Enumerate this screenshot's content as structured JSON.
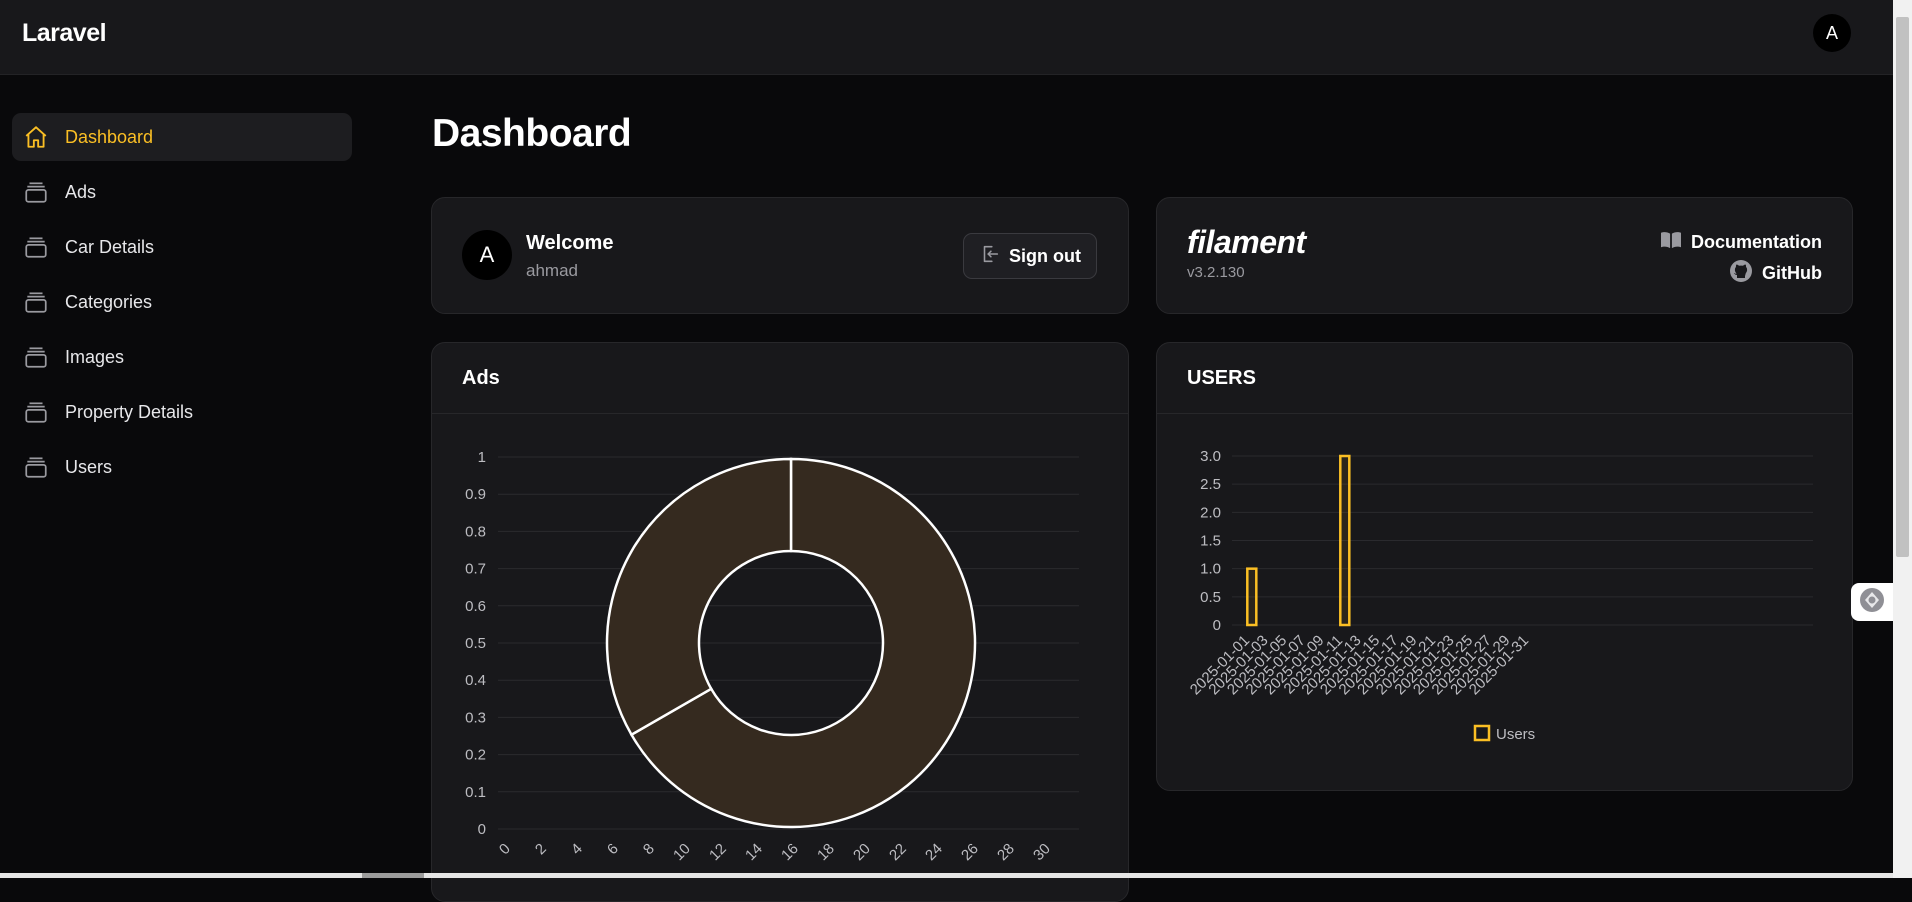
{
  "app": {
    "brand": "Laravel",
    "avatar_initial": "A"
  },
  "sidebar": {
    "items": [
      {
        "label": "Dashboard",
        "icon": "home-icon",
        "active": true
      },
      {
        "label": "Ads",
        "icon": "stack-icon"
      },
      {
        "label": "Car Details",
        "icon": "stack-icon"
      },
      {
        "label": "Categories",
        "icon": "stack-icon"
      },
      {
        "label": "Images",
        "icon": "stack-icon"
      },
      {
        "label": "Property Details",
        "icon": "stack-icon"
      },
      {
        "label": "Users",
        "icon": "stack-icon"
      }
    ]
  },
  "page": {
    "title": "Dashboard"
  },
  "account_widget": {
    "avatar_initial": "A",
    "title": "Welcome",
    "username": "ahmad",
    "sign_out_label": "Sign out"
  },
  "filament_widget": {
    "logo": "filament",
    "version": "v3.2.130",
    "documentation_label": "Documentation",
    "github_label": "GitHub"
  },
  "colors": {
    "accent": "#fbbf24",
    "background": "#09090b",
    "card": "#18181b",
    "doughnut_fill": "#352a1f"
  },
  "chart_data": [
    {
      "title": "Ads",
      "type": "doughnut",
      "slices": [
        {
          "value": 0.667,
          "color": "#352a1f"
        },
        {
          "value": 0.333,
          "color": "#352a1f"
        }
      ],
      "x_ticks": [
        "0",
        "2",
        "4",
        "6",
        "8",
        "10",
        "12",
        "14",
        "16",
        "18",
        "20",
        "22",
        "24",
        "26",
        "28",
        "30"
      ],
      "y_ticks": [
        "1",
        "0.9",
        "0.8",
        "0.7",
        "0.6",
        "0.5",
        "0.4",
        "0.3",
        "0.2",
        "0.1",
        "0"
      ],
      "ylim": [
        0,
        1
      ]
    },
    {
      "title": "USERS",
      "type": "bar",
      "series": [
        {
          "name": "Users",
          "color": "#fbbf24",
          "values": [
            {
              "x": "2025-01-02",
              "y": 1
            },
            {
              "x": "2025-01-12",
              "y": 3
            }
          ]
        }
      ],
      "x_ticks": [
        "2025-01-01",
        "2025-01-03",
        "2025-01-05",
        "2025-01-07",
        "2025-01-09",
        "2025-01-11",
        "2025-01-13",
        "2025-01-15",
        "2025-01-17",
        "2025-01-19",
        "2025-01-21",
        "2025-01-23",
        "2025-01-25",
        "2025-01-27",
        "2025-01-29",
        "2025-01-31"
      ],
      "y_ticks": [
        "3.0",
        "2.5",
        "2.0",
        "1.5",
        "1.0",
        "0.5",
        "0"
      ],
      "ylim": [
        0,
        3
      ],
      "legend": "bottom-center"
    }
  ]
}
